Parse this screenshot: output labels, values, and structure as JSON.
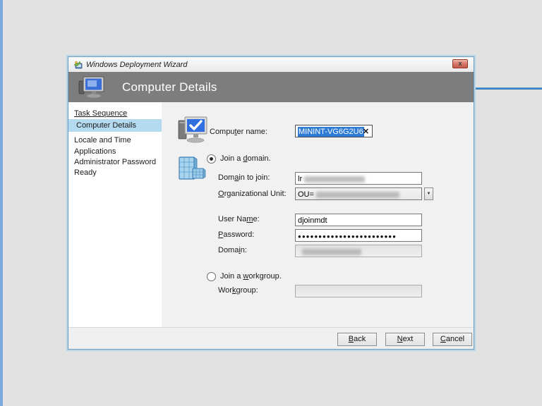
{
  "titlebar": {
    "title": "Windows Deployment Wizard",
    "close_glyph": "x"
  },
  "header": {
    "title": "Computer Details"
  },
  "sidebar": {
    "items": [
      "Task Sequence",
      "Computer Details",
      "Locale and Time",
      "Applications",
      "Administrator Password",
      "Ready"
    ]
  },
  "form": {
    "computer_name": {
      "label_pre": "Compu",
      "label_key": "t",
      "label_post": "er name:",
      "value": "MININT-VG6G2U6",
      "clear_glyph": "✕",
      "selected": true
    },
    "join_domain": {
      "label_pre": "Join a ",
      "label_key": "d",
      "label_post": "omain.",
      "selected": true
    },
    "domain_to_join": {
      "label_pre": "Dom",
      "label_key": "a",
      "label_post": "in to join:",
      "value_prefix": "lr",
      "rest_redacted": true
    },
    "organizational_unit": {
      "label_pre": "",
      "label_key": "O",
      "label_post": "rganizational Unit:",
      "value_prefix": "OU=",
      "rest_redacted": true,
      "dropdown_glyph": "▼"
    },
    "user_name": {
      "label_pre": "User Na",
      "label_key": "m",
      "label_post": "e:",
      "value": "djoinmdt"
    },
    "password": {
      "label_pre": "",
      "label_key": "P",
      "label_post": "assword:",
      "value": "●●●●●●●●●●●●●●●●●●●●●●●●"
    },
    "domain_readonly": {
      "label_pre": "Doma",
      "label_key": "i",
      "label_post": "n:",
      "value_redacted": true,
      "disabled": true
    },
    "join_workgroup": {
      "label_pre": "Join a ",
      "label_key": "w",
      "label_post": "orkgroup.",
      "selected": false
    },
    "workgroup": {
      "label_pre": "Wor",
      "label_key": "k",
      "label_post": "group:",
      "value": "",
      "disabled": true
    }
  },
  "buttons": {
    "back_key": "B",
    "back_rest": "ack",
    "next_key": "N",
    "next_rest": "ext",
    "cancel_key": "C",
    "cancel_rest": "ancel"
  },
  "icons": {
    "app": "wizard-app-icon",
    "header": "computer-monitor-icon",
    "computer_name": "computer-check-icon",
    "domain": "domain-servers-icon",
    "close": "✕",
    "clear": "✕",
    "dropdown": "▼"
  },
  "colors": {
    "header_bg": "#7d7d7d",
    "sidebar_highlight": "#b3daee",
    "selection_blue": "#2f7cd6",
    "accent_line": "#2a7cc0",
    "left_stripe": "#7aabda",
    "close_button": "#d87b6d"
  }
}
